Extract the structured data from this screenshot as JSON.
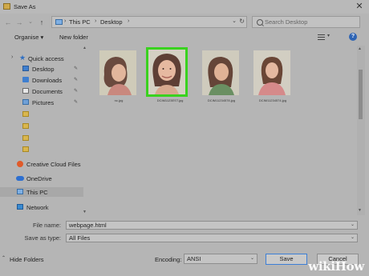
{
  "window": {
    "title": "Save As",
    "close_glyph": "✕"
  },
  "nav": {
    "back": "←",
    "forward": "→",
    "history": "⌄",
    "up": "↑"
  },
  "address": {
    "crumbs": [
      "This PC",
      "Desktop"
    ],
    "separator": "›",
    "dropdown": "⌄",
    "refresh": "↻"
  },
  "search": {
    "placeholder": "Search Desktop"
  },
  "toolbar": {
    "organise": "Organise ▾",
    "new_folder": "New folder",
    "view_dd": "▾",
    "help": "?"
  },
  "sidebar": {
    "items": [
      {
        "label": "Quick access",
        "icon": "star-icon",
        "pinned": false
      },
      {
        "label": "Desktop",
        "icon": "desktop-icon",
        "pinned": true
      },
      {
        "label": "Downloads",
        "icon": "downloads-icon",
        "pinned": true
      },
      {
        "label": "Documents",
        "icon": "documents-icon",
        "pinned": true
      },
      {
        "label": "Pictures",
        "icon": "pictures-icon",
        "pinned": true
      },
      {
        "label": "",
        "icon": "folder-icon"
      },
      {
        "label": "",
        "icon": "folder-icon"
      },
      {
        "label": "",
        "icon": "folder-icon"
      },
      {
        "label": "",
        "icon": "folder-icon"
      },
      {
        "label": "Creative Cloud Files",
        "icon": "creative-cloud-icon"
      },
      {
        "label": "OneDrive",
        "icon": "onedrive-icon"
      },
      {
        "label": "This PC",
        "icon": "this-pc-icon",
        "selected": true
      },
      {
        "label": "Network",
        "icon": "network-icon"
      }
    ],
    "pin_glyph": "✎",
    "expand_glyph": "›",
    "scroll_up": "▲",
    "scroll_down": "▼"
  },
  "files": [
    {
      "caption": "nc.jpg",
      "selected": false
    },
    {
      "caption": "DCIM1123EST.jpg",
      "selected": true
    },
    {
      "caption": "DCIM11234578.jpg",
      "selected": false
    },
    {
      "caption": "DCIM11234574.jpg",
      "selected": false
    }
  ],
  "scroll": {
    "up": "▲",
    "down": "▼"
  },
  "form": {
    "file_name_label": "File name:",
    "file_name_value": "webpage.html",
    "save_type_label": "Save as type:",
    "save_type_value": "All Files",
    "dd": "⌄"
  },
  "footer": {
    "hide_folders": "Hide Folders",
    "hide_arrow": "⌃",
    "encoding_label": "Encoding:",
    "encoding_value": "ANSI",
    "save": "Save",
    "cancel": "Cancel"
  },
  "watermark": {
    "wiki": "wiki",
    "how": "How"
  },
  "colors": {
    "selection": "#39d21f",
    "help": "#2e64b4"
  }
}
